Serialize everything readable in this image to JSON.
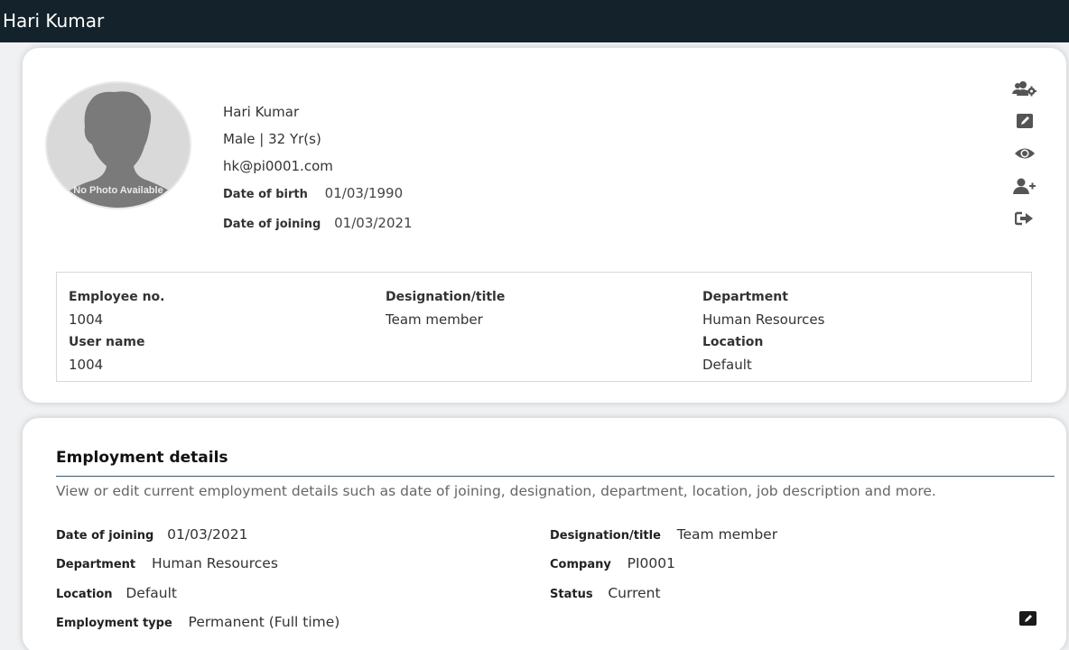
{
  "header": {
    "title": "Hari Kumar"
  },
  "profile": {
    "avatar_text": "No Photo Available",
    "name": "Hari Kumar",
    "gender_age": "Male | 32 Yr(s)",
    "email": "hk@pi0001.com",
    "dob_label": "Date of birth",
    "dob_value": "01/03/1990",
    "doj_label": "Date of joining",
    "doj_value": "01/03/2021"
  },
  "actions": [
    {
      "name": "manage-users",
      "icon": "users-gear-icon"
    },
    {
      "name": "edit",
      "icon": "edit-icon"
    },
    {
      "name": "view",
      "icon": "eye-icon"
    },
    {
      "name": "add-user",
      "icon": "user-plus-icon"
    },
    {
      "name": "sign-out",
      "icon": "sign-out-icon"
    }
  ],
  "summary": {
    "employee_no_label": "Employee no.",
    "employee_no_value": "1004",
    "designation_label": "Designation/title",
    "designation_value": "Team member",
    "department_label": "Department",
    "department_value": "Human Resources",
    "username_label": "User name",
    "username_value": "1004",
    "location_label": "Location",
    "location_value": "Default"
  },
  "employment": {
    "title": "Employment details",
    "description": "View or edit current employment details such as date of joining, designation, department, location, job description and more.",
    "fields_left": [
      {
        "label": "Date of joining",
        "value": "01/03/2021"
      },
      {
        "label": "Department",
        "value": "Human Resources"
      },
      {
        "label": "Location",
        "value": "Default"
      },
      {
        "label": "Employment type",
        "value": "Permanent (Full time)"
      }
    ],
    "fields_right": [
      {
        "label": "Designation/title",
        "value": "Team member"
      },
      {
        "label": "Company",
        "value": "PI0001"
      },
      {
        "label": "Status",
        "value": "Current"
      }
    ]
  },
  "colors": {
    "header_bg": "#14232b",
    "icon_gray": "#555555",
    "rule": "#2f5b73"
  }
}
